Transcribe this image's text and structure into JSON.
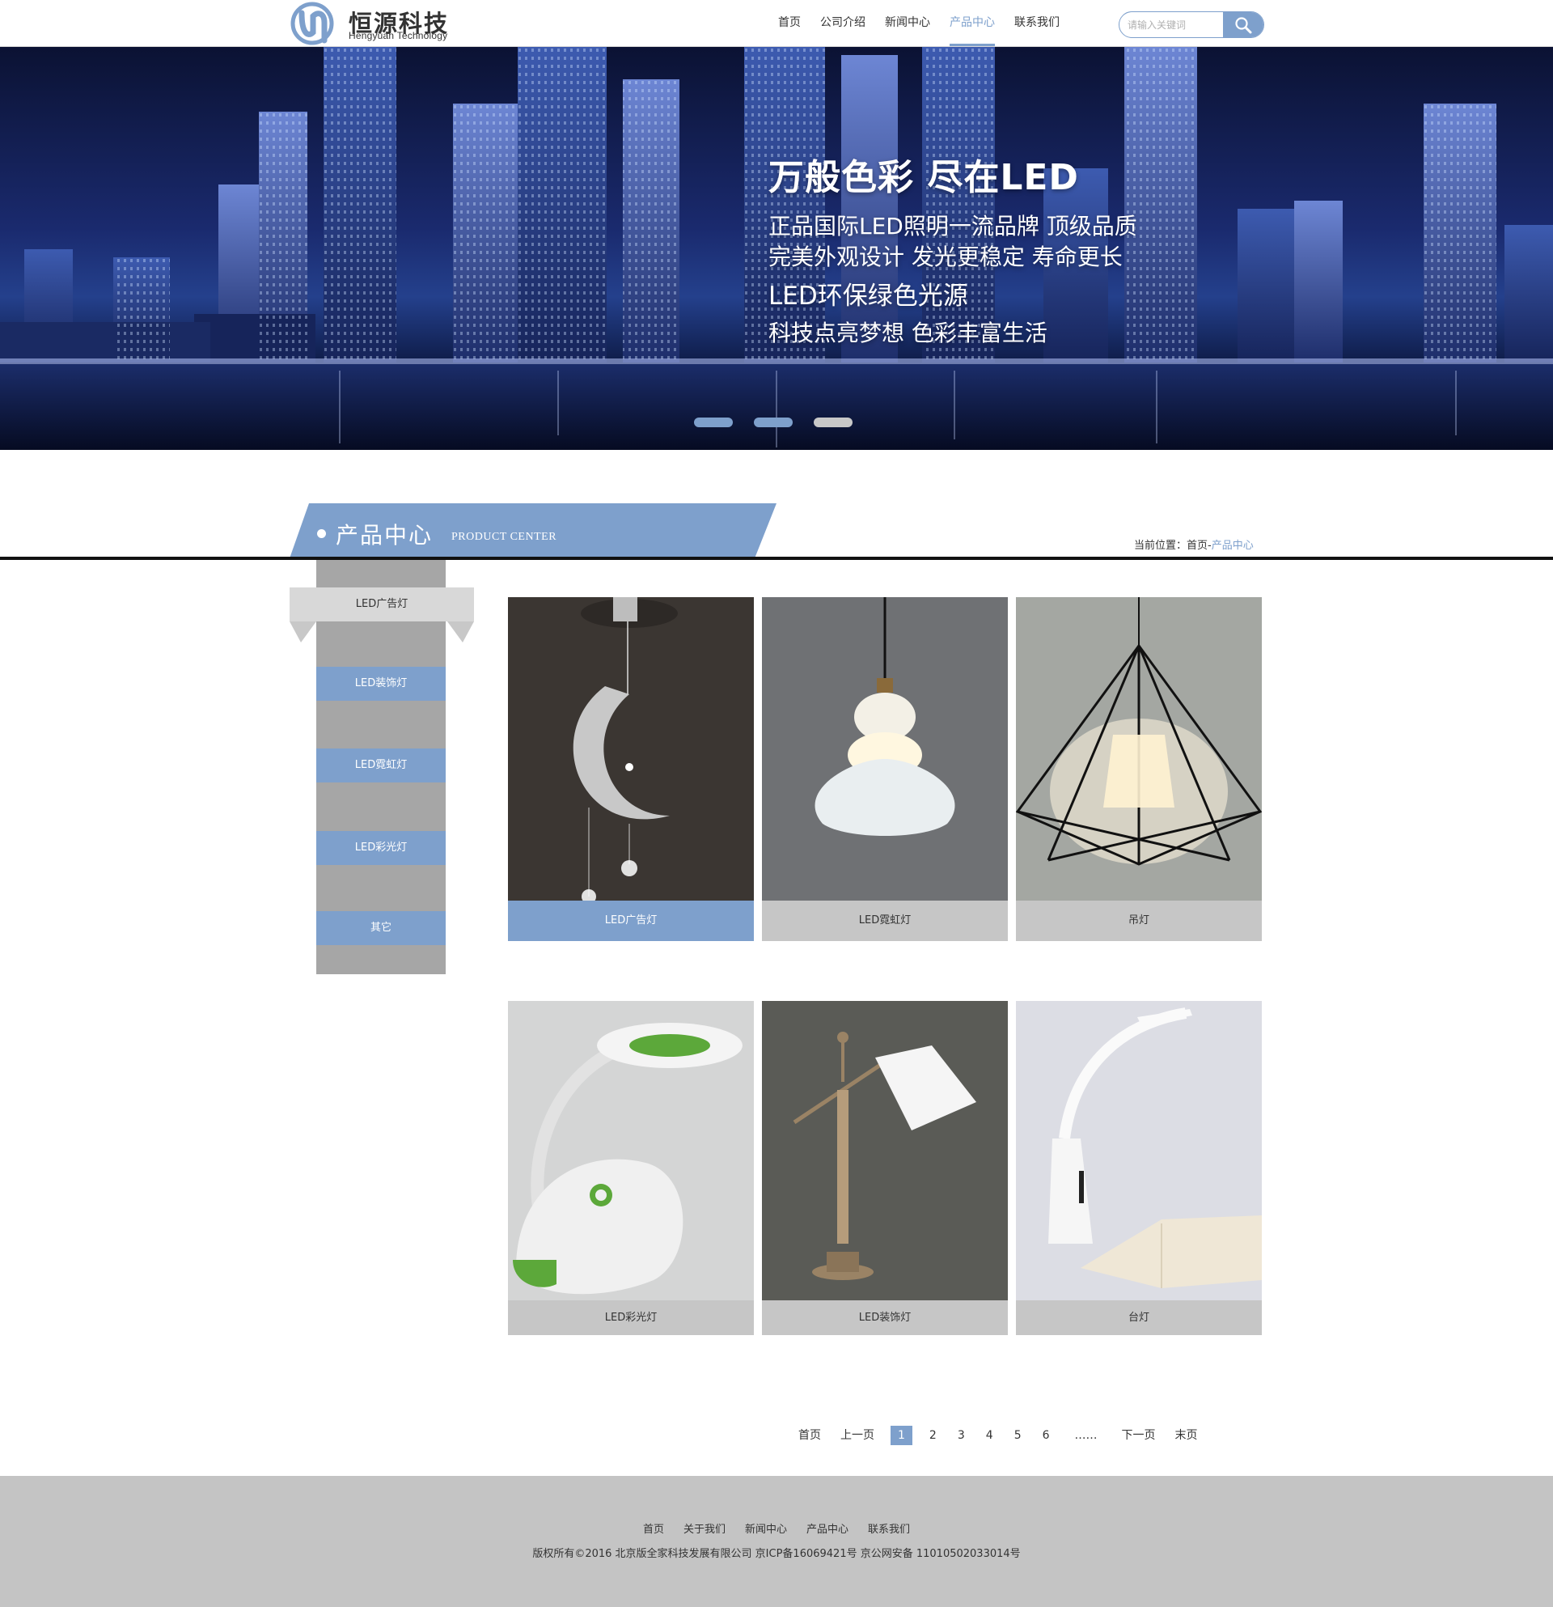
{
  "header": {
    "logo_cn": "恒源科技",
    "logo_en": "Hengyuan Technology",
    "nav": [
      "首页",
      "公司介绍",
      "新闻中心",
      "产品中心",
      "联系我们"
    ],
    "nav_active": "产品中心",
    "search_placeholder": "请输入关键词",
    "search_icon": "search-icon"
  },
  "banner": {
    "title": "万般色彩 尽在LED",
    "line1": "正品国际LED照明一流品牌 顶级品质",
    "line2": "完美外观设计 发光更稳定 寿命更长",
    "line3": "LED环保绿色光源",
    "line4": "科技点亮梦想 色彩丰富生活",
    "slides": 3,
    "active_slide": 1
  },
  "section": {
    "title_cn": "产品中心",
    "title_en": "PRODUCT CENTER",
    "breadcrumb_prefix": "当前位置：",
    "breadcrumb_home": "首页",
    "breadcrumb_sep": "-",
    "breadcrumb_current": "产品中心"
  },
  "sidebar": {
    "active": "LED广告灯",
    "items": [
      "LED装饰灯",
      "LED霓虹灯",
      "LED彩光灯",
      "其它"
    ]
  },
  "products": [
    {
      "caption": "LED广告灯",
      "image": "crescent-moon-pendant-lamp"
    },
    {
      "caption": "LED霓虹灯",
      "image": "white-glass-pendant-lamp"
    },
    {
      "caption": "吊灯",
      "image": "geometric-wire-pendant-lamp"
    },
    {
      "caption": "LED彩光灯",
      "image": "green-white-desk-lamp"
    },
    {
      "caption": "LED装饰灯",
      "image": "brass-table-lamp"
    },
    {
      "caption": "台灯",
      "image": "white-led-desk-lamp-with-book"
    }
  ],
  "pager": {
    "first": "首页",
    "prev": "上一页",
    "pages": [
      "1",
      "2",
      "3",
      "4",
      "5",
      "6"
    ],
    "current": "1",
    "ellipsis": "……",
    "next": "下一页",
    "last": "末页"
  },
  "footer": {
    "nav": [
      "首页",
      "关于我们",
      "新闻中心",
      "产品中心",
      "联系我们"
    ],
    "copyright": "版权所有©2016  北京版全家科技发展有限公司  京ICP备16069421号   京公网安备  11010502033014号"
  },
  "colors": {
    "accent": "#7ea0cc",
    "sidebar": "#a6a6a6",
    "footer": "#c4c4c4"
  }
}
